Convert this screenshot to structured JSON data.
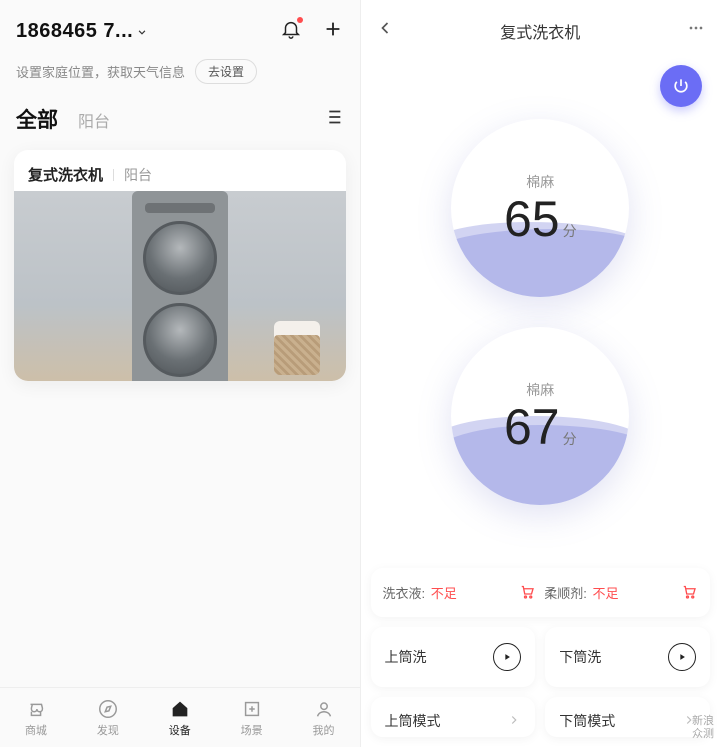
{
  "left": {
    "account": "1868465 7... ",
    "weather_tip": "设置家庭位置，获取天气信息",
    "go_settings": "去设置",
    "tabs": {
      "all": "全部",
      "room": "阳台"
    },
    "card": {
      "title": "复式洗衣机",
      "room": "阳台"
    },
    "bottom_nav": [
      {
        "label": "商城"
      },
      {
        "label": "发现"
      },
      {
        "label": "设备"
      },
      {
        "label": "场景"
      },
      {
        "label": "我的"
      }
    ]
  },
  "right": {
    "title": "复式洗衣机",
    "dial1": {
      "mode": "棉麻",
      "value": "65",
      "unit": "分"
    },
    "dial2": {
      "mode": "棉麻",
      "value": "67",
      "unit": "分"
    },
    "supply": {
      "detergent_label": "洗衣液:",
      "detergent_value": "不足",
      "softener_label": "柔顺剂:",
      "softener_value": "不足"
    },
    "actions": {
      "top_wash": "上筒洗",
      "bottom_wash": "下筒洗",
      "top_mode": "上筒模式",
      "bottom_mode": "下筒模式"
    }
  },
  "watermark": {
    "l1": "新浪",
    "l2": "众测"
  }
}
